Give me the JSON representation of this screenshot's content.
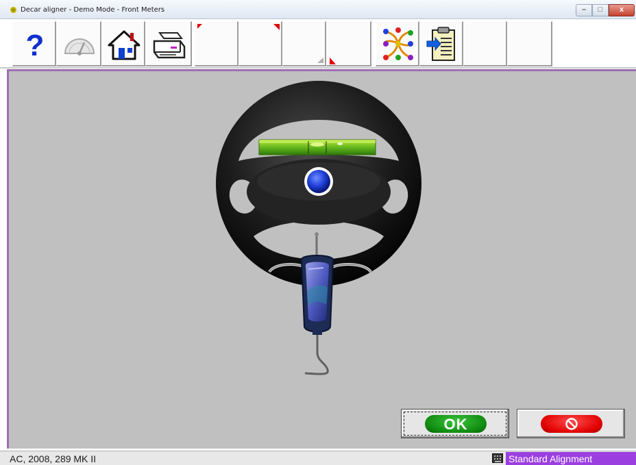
{
  "window": {
    "title": "Decar aligner - Demo Mode  -  Front Meters",
    "close_label": "x"
  },
  "toolbar": {
    "buttons": [
      {
        "name": "help",
        "icon": "question-mark-icon"
      },
      {
        "name": "meters",
        "icon": "gauge-icon"
      },
      {
        "name": "home",
        "icon": "home-icon"
      },
      {
        "name": "print",
        "icon": "printer-icon"
      },
      {
        "name": "blank-1",
        "icon": "red-corner-top-left-icon"
      },
      {
        "name": "blank-2",
        "icon": "red-corner-top-right-icon"
      },
      {
        "name": "blank-3",
        "icon": "none"
      },
      {
        "name": "blank-4",
        "icon": "red-corner-bottom-icon"
      },
      {
        "name": "procedure",
        "icon": "flowchart-icon"
      },
      {
        "name": "report",
        "icon": "clipboard-icon"
      },
      {
        "name": "blank-5",
        "icon": "none"
      },
      {
        "name": "blank-6",
        "icon": "none"
      }
    ]
  },
  "scene": {
    "description_icon": "steering-wheel-with-level-and-hanging-sensor",
    "level_color": "#5fb31a",
    "hub_color": "#1f3fd8"
  },
  "actions": {
    "ok_label": "OK",
    "ok_color": "#0f8a0f",
    "cancel_icon": "no-entry-icon",
    "cancel_color": "#e00000"
  },
  "status": {
    "vehicle": "AC, 2008, 289 MK II",
    "mode": "Standard Alignment",
    "mode_color": "#9b3fe0"
  }
}
